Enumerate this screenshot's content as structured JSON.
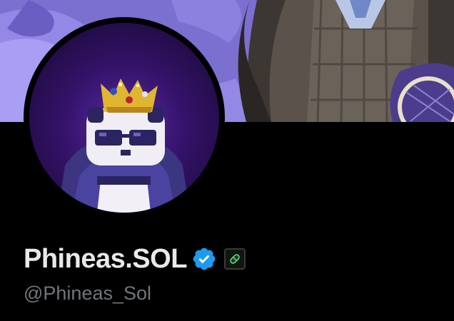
{
  "profile": {
    "display_name": "Phineas.SOL",
    "handle": "@Phineas_Sol",
    "verified_icon": "verified-badge-icon",
    "affiliate_icon": "green-pill-icon"
  },
  "banner": {
    "image": "banner-illustration",
    "colors": {
      "sky": "#7b6fd0",
      "cloud": "#9d8ff0",
      "suit": "#4a4540"
    }
  },
  "avatar": {
    "image": "pixel-panda-with-crown-avatar",
    "colors": {
      "background": "#331268",
      "crown": "#e0b630"
    }
  },
  "colors": {
    "background": "#000000",
    "name": "#e7e9ea",
    "handle": "#71767b",
    "verified": "#1d9bf0"
  }
}
